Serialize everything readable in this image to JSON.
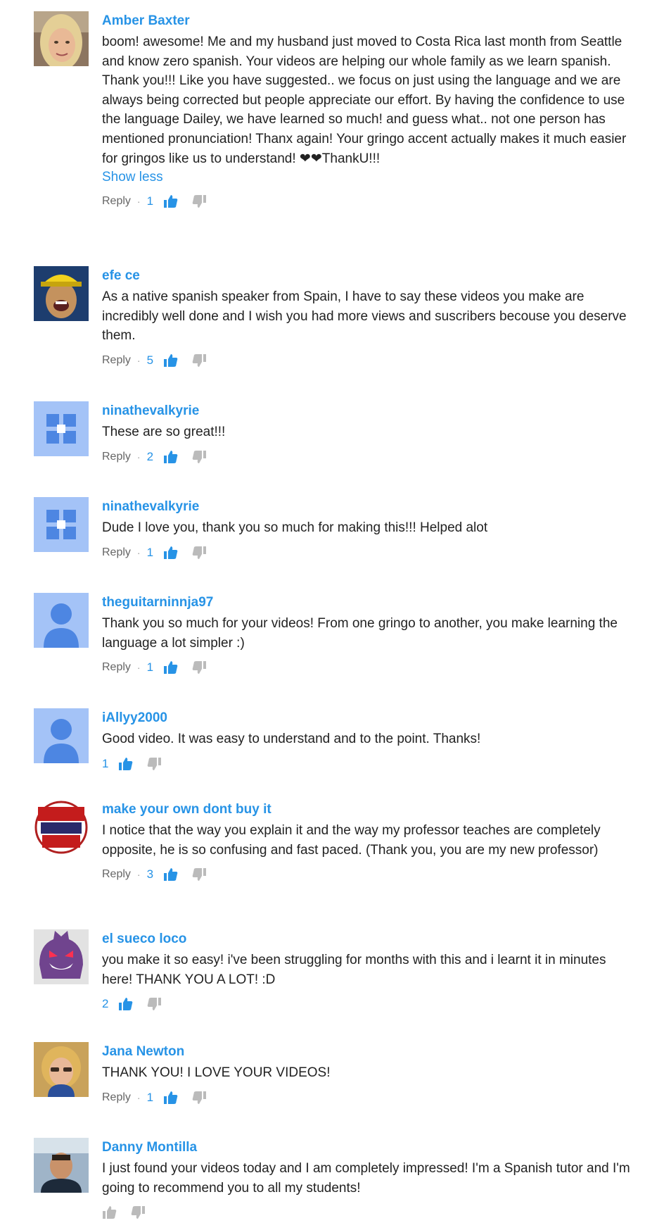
{
  "colors": {
    "author": "#2793e6",
    "text": "#222222",
    "meta": "#666666",
    "like_active": "#2793e6",
    "dislike": "#bbbbbb"
  },
  "comments": [
    {
      "author": "Amber Baxter",
      "avatar": "photo-woman-blonde",
      "text": "boom! awesome! Me and my husband just moved to Costa Rica last month from Seattle and know zero spanish. Your videos are helping our whole family as we learn spanish. Thank you!!! Like you have suggested.. we focus on just using the language and we are always being corrected but people appreciate our effort. By having the confidence to use the language Dailey, we have learned so much! and guess what.. not one person has mentioned pronunciation! Thanx again! Your gringo accent actually makes it much easier for gringos like us to understand! ❤❤ThankU!!!",
      "show_less": "Show less",
      "reply": "Reply",
      "likes": "1"
    },
    {
      "author": "efe ce",
      "avatar": "photo-man-yellow-hat",
      "text": "As a native spanish speaker from Spain, I have to say these videos you make are incredibly well done and I wish you had more views and suscribers becouse you deserve them.",
      "reply": "Reply",
      "likes": "5"
    },
    {
      "author": "ninathevalkyrie",
      "avatar": "default-puzzle-avatar",
      "text": "These are so great!!!",
      "reply": "Reply",
      "likes": "2"
    },
    {
      "author": "ninathevalkyrie",
      "avatar": "default-puzzle-avatar",
      "text": "Dude I love you, thank you so much for making this!!! Helped alot",
      "reply": "Reply",
      "likes": "1"
    },
    {
      "author": "theguitarninnja97",
      "avatar": "default-person-avatar",
      "text": "Thank you so much for your videos! From one gringo to another, you make learning the language a lot simpler :)",
      "reply": "Reply",
      "likes": "1"
    },
    {
      "author": "iAllyy2000",
      "avatar": "default-person-avatar",
      "text": "Good video. It was easy to understand and to the point. Thanks!",
      "likes": "1"
    },
    {
      "author": "make your own dont buy it",
      "avatar": "logo-make-your-own",
      "text": "I notice that the way you explain it and the way my professor teaches are completely opposite, he is so confusing and fast paced. (Thank you, you are my new professor)",
      "reply": "Reply",
      "likes": "3"
    },
    {
      "author": "el sueco loco",
      "avatar": "purple-ghost-cartoon",
      "text": "you make it so easy! i've been struggling for months with this and i learnt it in minutes here! THANK YOU A LOT! :D",
      "likes": "2"
    },
    {
      "author": "Jana Newton",
      "avatar": "photo-woman-sunglasses",
      "text": "THANK YOU! I LOVE YOUR VIDEOS!",
      "reply": "Reply",
      "likes": "1"
    },
    {
      "author": "Danny Montilla",
      "avatar": "photo-man-outdoors",
      "text": "I just found your videos today and I am completely impressed! I'm a Spanish tutor and I'm going to recommend you to all my students!",
      "likes": ""
    }
  ]
}
